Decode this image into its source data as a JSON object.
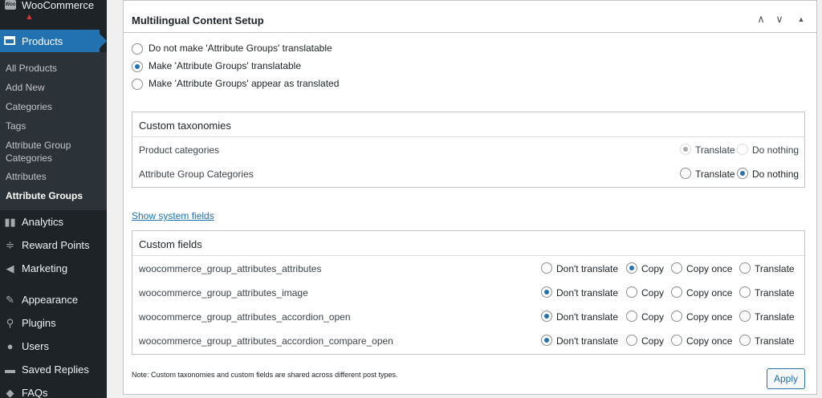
{
  "sidebar": {
    "woocommerce_label": "WooCommerce",
    "woocommerce_icon": "Woo",
    "products_label": "Products",
    "submenu": [
      "All Products",
      "Add New",
      "Categories",
      "Tags",
      "Attribute Group Categories",
      "Attributes",
      "Attribute Groups"
    ],
    "menu": [
      {
        "label": "Analytics",
        "icon": "▮▮"
      },
      {
        "label": "Reward Points",
        "icon": "≑"
      },
      {
        "label": "Marketing",
        "icon": "◀"
      },
      {
        "label": "Appearance",
        "icon": "✎"
      },
      {
        "label": "Plugins",
        "icon": "⚲"
      },
      {
        "label": "Users",
        "icon": "●"
      },
      {
        "label": "Saved Replies",
        "icon": "▬"
      },
      {
        "label": "FAQs",
        "icon": "◆"
      }
    ]
  },
  "panel": {
    "title": "Multilingual Content Setup",
    "options": [
      {
        "label": "Do not make 'Attribute Groups' translatable",
        "checked": false
      },
      {
        "label": "Make 'Attribute Groups' translatable",
        "checked": true
      },
      {
        "label": "Make 'Attribute Groups' appear as translated",
        "checked": false
      }
    ],
    "taxonomies": {
      "title": "Custom taxonomies",
      "choices": [
        "Translate",
        "Do nothing"
      ],
      "rows": [
        {
          "name": "Product categories",
          "selected": 0,
          "disabled": true
        },
        {
          "name": "Attribute Group Categories",
          "selected": 1,
          "disabled": false
        }
      ]
    },
    "show_system_fields": "Show system fields",
    "fields": {
      "title": "Custom fields",
      "choices": [
        "Don't translate",
        "Copy",
        "Copy once",
        "Translate"
      ],
      "rows": [
        {
          "name": "woocommerce_group_attributes_attributes",
          "selected": 1
        },
        {
          "name": "woocommerce_group_attributes_image",
          "selected": 0
        },
        {
          "name": "woocommerce_group_attributes_accordion_open",
          "selected": 0
        },
        {
          "name": "woocommerce_group_attributes_accordion_compare_open",
          "selected": 0
        }
      ]
    },
    "note": "Note: Custom taxonomies and custom fields are shared across different post types.",
    "apply_label": "Apply"
  },
  "colors": {
    "accent": "#2271b1",
    "sidebar": "#1d2327",
    "submenu": "#2c3338",
    "warning": "#d63638"
  }
}
